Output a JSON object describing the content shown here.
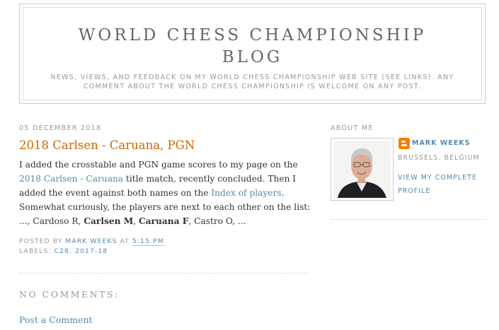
{
  "header": {
    "title_line1": "WORLD CHESS CHAMPIONSHIP",
    "title_line2": "BLOG",
    "description_line1": "NEWS, VIEWS, AND FEEDBACK ON MY WORLD CHESS CHAMPIONSHIP WEB SITE (SEE LINKS). ANY",
    "description_line2": "COMMENT ABOUT THE WORLD CHESS CHAMPIONSHIP IS WELCOME ON ANY POST."
  },
  "post": {
    "date": "05 DECEMBER 2018",
    "title": "2018 Carlsen - Caruana, PGN",
    "body": {
      "t1": "I added the crosstable and PGN game scores to my page on the ",
      "link1": "2018 Carlsen - Caruana",
      "t2": " title match, recently concluded. Then I added the event against both names on the ",
      "link2": "Index of players",
      "t3": ". Somewhat curiously, the players are next to each other on the list: ..., Cardoso R, ",
      "bold1": "Carlsen M",
      "t4": ", ",
      "bold2": "Caruana F",
      "t5": ", Castro O, ..."
    },
    "footer": {
      "posted_by": "POSTED BY",
      "author": "MARK WEEKS",
      "at": "AT",
      "time": "5:15 PM",
      "labels_prefix": "LABELS:",
      "label": "C28: 2017-18"
    }
  },
  "comments": {
    "heading": "NO COMMENTS:",
    "post_link": "Post a Comment"
  },
  "sidebar": {
    "heading": "ABOUT ME",
    "profile_name": "MARK WEEKS",
    "location": "BRUSSELS, BELGIUM",
    "view_profile": "VIEW MY COMPLETE PROFILE"
  },
  "colors": {
    "title": "#666666",
    "post_title": "#cc6600",
    "link": "#5588aa",
    "meta": "#999999",
    "blogger": "#f57d00"
  }
}
